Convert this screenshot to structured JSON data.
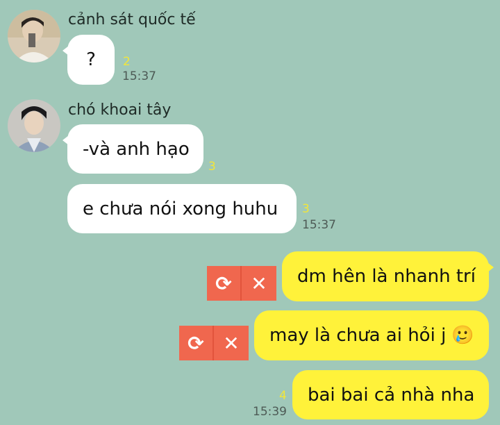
{
  "messages": [
    {
      "sender": "cảnh sát quốc tế",
      "avatar_icon": "user-avatar-1",
      "bubbles": [
        {
          "text": "?",
          "unread": "2",
          "time": "15:37"
        }
      ]
    },
    {
      "sender": "chó khoai tây",
      "avatar_icon": "user-avatar-2",
      "bubbles": [
        {
          "text": "-và anh hạo",
          "unread": "3",
          "time": ""
        },
        {
          "text": "e chưa nói xong huhu",
          "unread": "3",
          "time": "15:37"
        }
      ]
    },
    {
      "sender": "",
      "mine": true,
      "bubbles": [
        {
          "text": "dm hên là nhanh trí",
          "status": "failed"
        },
        {
          "text": "may là chưa ai hỏi j",
          "emoji": "🥲",
          "status": "failed"
        },
        {
          "text": "bai bai cả nhà nha",
          "unread": "4",
          "time": "15:39"
        }
      ]
    }
  ],
  "actions": {
    "retry_icon": "⟳",
    "cancel_icon": "✕"
  },
  "colors": {
    "background": "#a0c8b9",
    "incoming_bubble": "#ffffff",
    "outgoing_bubble": "#fff23a",
    "unread_count": "#f2e63a",
    "failed_action": "#f0674e"
  }
}
